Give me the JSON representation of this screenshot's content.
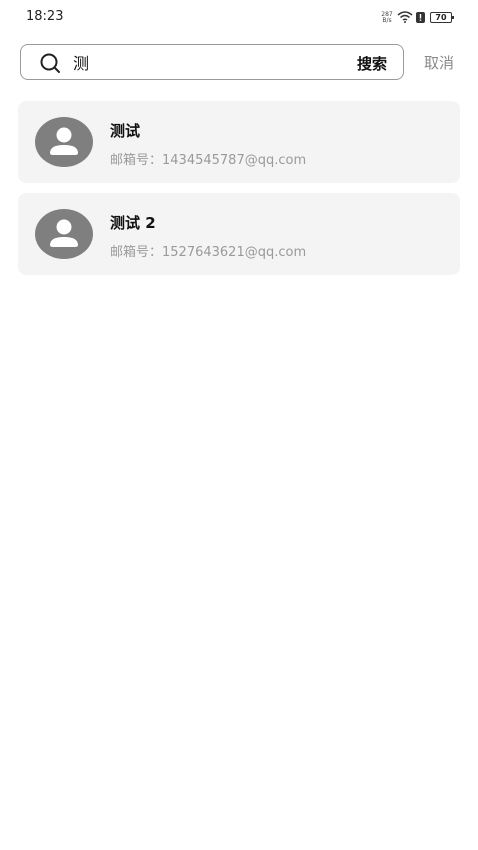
{
  "status_bar": {
    "time": "18:23",
    "net_speed_value": "287",
    "net_speed_unit": "B/s",
    "battery": "70"
  },
  "search": {
    "query": "测",
    "button_label": "搜索",
    "cancel_label": "取消"
  },
  "results": [
    {
      "name": "测试",
      "email": "邮箱号：1434545787@qq.com"
    },
    {
      "name": "测试 2",
      "email": "邮箱号：1527643621@qq.com"
    }
  ],
  "colors": {
    "card_bg": "#f4f4f4",
    "avatar_gray": "#7f7f7f",
    "secondary_text": "#9a9a9a"
  }
}
